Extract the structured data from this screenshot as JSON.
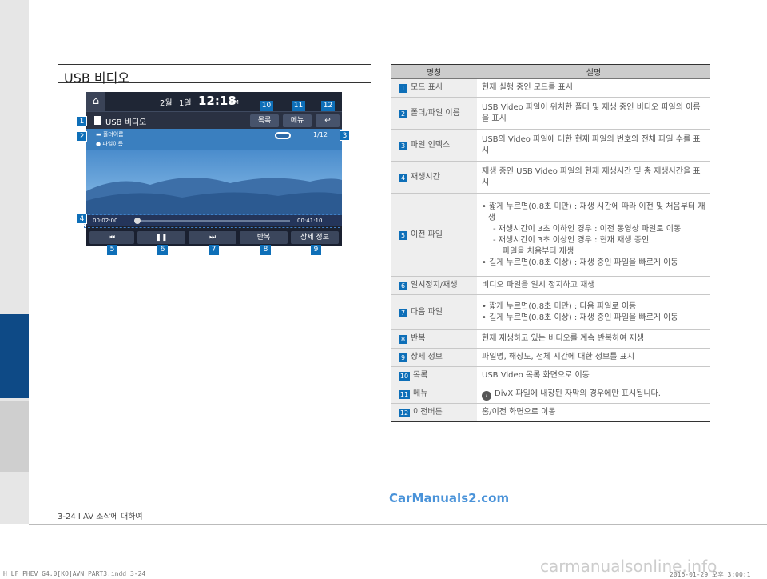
{
  "section_title": "USB 비디오",
  "screen": {
    "date_month": "2월",
    "date_day": "1일",
    "clock": "12:18",
    "ampm": "AM",
    "title": "USB 비디오",
    "btn_list": "목록",
    "btn_menu": "메뉴",
    "folder_name": "폴더이름",
    "file_name": "파일이름",
    "file_index": "1/12",
    "elapsed": "00:02:00",
    "total": "00:41:10",
    "btn_repeat": "반복",
    "btn_detail": "상세 정보"
  },
  "callouts": [
    "1",
    "2",
    "3",
    "4",
    "5",
    "6",
    "7",
    "8",
    "9",
    "10",
    "11",
    "12"
  ],
  "table": {
    "header_name": "명칭",
    "header_desc": "설명",
    "rows": [
      {
        "num": "1",
        "name": "모드 표시",
        "desc": [
          "현재 실행 중인 모드를 표시"
        ]
      },
      {
        "num": "2",
        "name": "폴더/파일 이름",
        "desc": [
          "USB Video 파일이 위치한 폴더 및 재생 중인 비디오 파일의 이름을 표시"
        ]
      },
      {
        "num": "3",
        "name": "파일 인덱스",
        "desc": [
          "USB의 Video 파일에 대한 현재 파일의 번호와 전체 파일 수를 표시"
        ]
      },
      {
        "num": "4",
        "name": "재생시간",
        "desc": [
          "재생 중인 USB Video 파일의 현재 재생시간 및 총 재생시간을 표시"
        ]
      },
      {
        "num": "5",
        "name": "이전 파일",
        "desc": [
          "• 짧게 누르면(0.8초 미만) : 재생 시간에 따라 이전 및 처음부터 재생",
          "- 재생시간이 3초 이하인 경우 : 이전 동영상 파일로 이동",
          "- 재생시간이 3초 이상인 경우 : 현재 재생 중인",
          "파일을 처음부터 재생",
          "• 길게 누르면(0.8초 이상) : 재생 중인 파일을 빠르게 이동"
        ]
      },
      {
        "num": "6",
        "name": "일시정지/재생",
        "desc": [
          "비디오 파일을 일시 정지하고 재생"
        ]
      },
      {
        "num": "7",
        "name": "다음 파일",
        "desc": [
          "• 짧게 누르면(0.8초 미만) : 다음 파일로 이동",
          "• 길게 누르면(0.8초 이상) : 재생 중인 파일을 빠르게 이동"
        ]
      },
      {
        "num": "8",
        "name": "반복",
        "desc": [
          "현재 재생하고 있는 비디오를 계속 반복하여 재생"
        ]
      },
      {
        "num": "9",
        "name": "상세 정보",
        "desc": [
          "파일명, 해상도, 전체 시간에 대한 정보를 표시"
        ]
      },
      {
        "num": "10",
        "name": "목록",
        "desc": [
          "USB Video 목록 화면으로 이동"
        ]
      },
      {
        "num": "11",
        "name": "메뉴",
        "desc": [
          "DivX 파일에 내장된 자막의 경우에만 표시됩니다."
        ]
      },
      {
        "num": "12",
        "name": "이전버튼",
        "desc": [
          "홈/이전 화면으로 이동"
        ]
      }
    ]
  },
  "footer_page": "3-24 I AV 조작에 대하여",
  "watermark_site": "CarManuals2.com",
  "watermark_bottom": "carmanualsonline.info",
  "print_file": "H_LF PHEV_G4.0[KO]AVN_PART3.indd   3-24",
  "print_time": "2016-01-29  오후 3:00:1",
  "colors": {
    "accent": "#0e6fb8",
    "side_tab": "#0e4a86"
  }
}
